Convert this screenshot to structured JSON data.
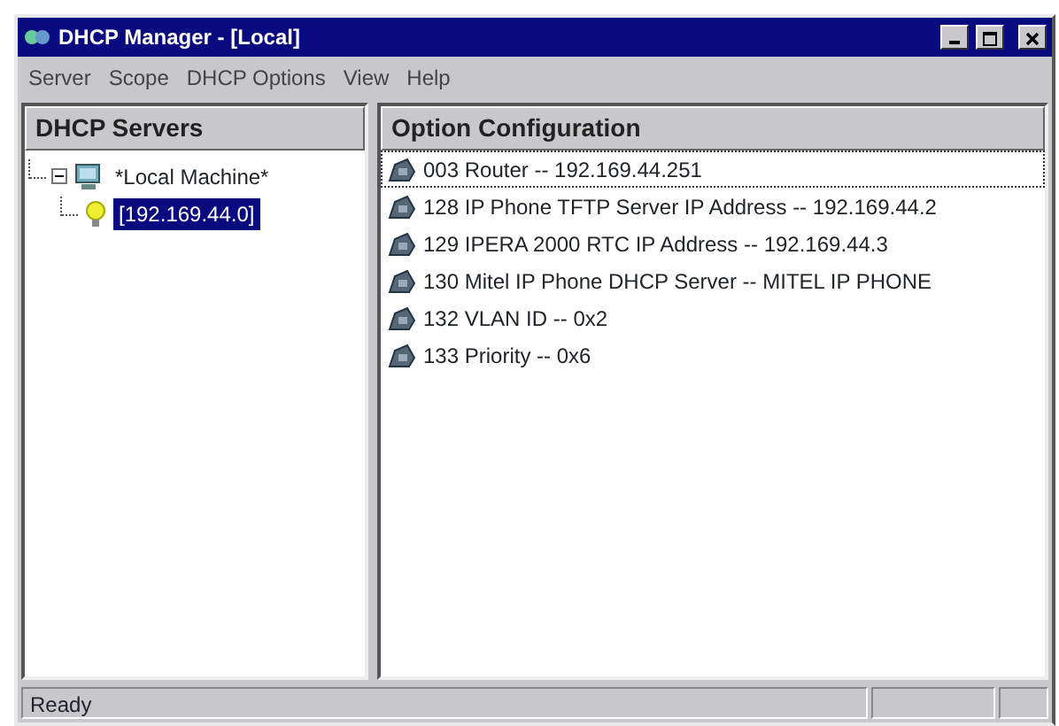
{
  "window": {
    "title": "DHCP Manager - [Local]"
  },
  "menu": [
    "Server",
    "Scope",
    "DHCP Options",
    "View",
    "Help"
  ],
  "servers_pane": {
    "header": "DHCP Servers",
    "tree": [
      {
        "label": "*Local Machine*",
        "kind": "machine",
        "expanded": true,
        "selected": false,
        "children": [
          {
            "label": "[192.169.44.0]",
            "kind": "scope",
            "selected": true
          }
        ]
      }
    ]
  },
  "options_pane": {
    "header": "Option Configuration",
    "items": [
      {
        "label": "003 Router -- 192.169.44.251",
        "selected": true
      },
      {
        "label": "128 IP Phone TFTP Server IP Address -- 192.169.44.2",
        "selected": false
      },
      {
        "label": "129 IPERA 2000 RTC IP Address -- 192.169.44.3",
        "selected": false
      },
      {
        "label": "130 Mitel IP Phone DHCP Server -- MITEL IP PHONE",
        "selected": false
      },
      {
        "label": "132 VLAN ID -- 0x2",
        "selected": false
      },
      {
        "label": "133 Priority -- 0x6",
        "selected": false
      }
    ]
  },
  "status_bar": {
    "text": "Ready"
  }
}
